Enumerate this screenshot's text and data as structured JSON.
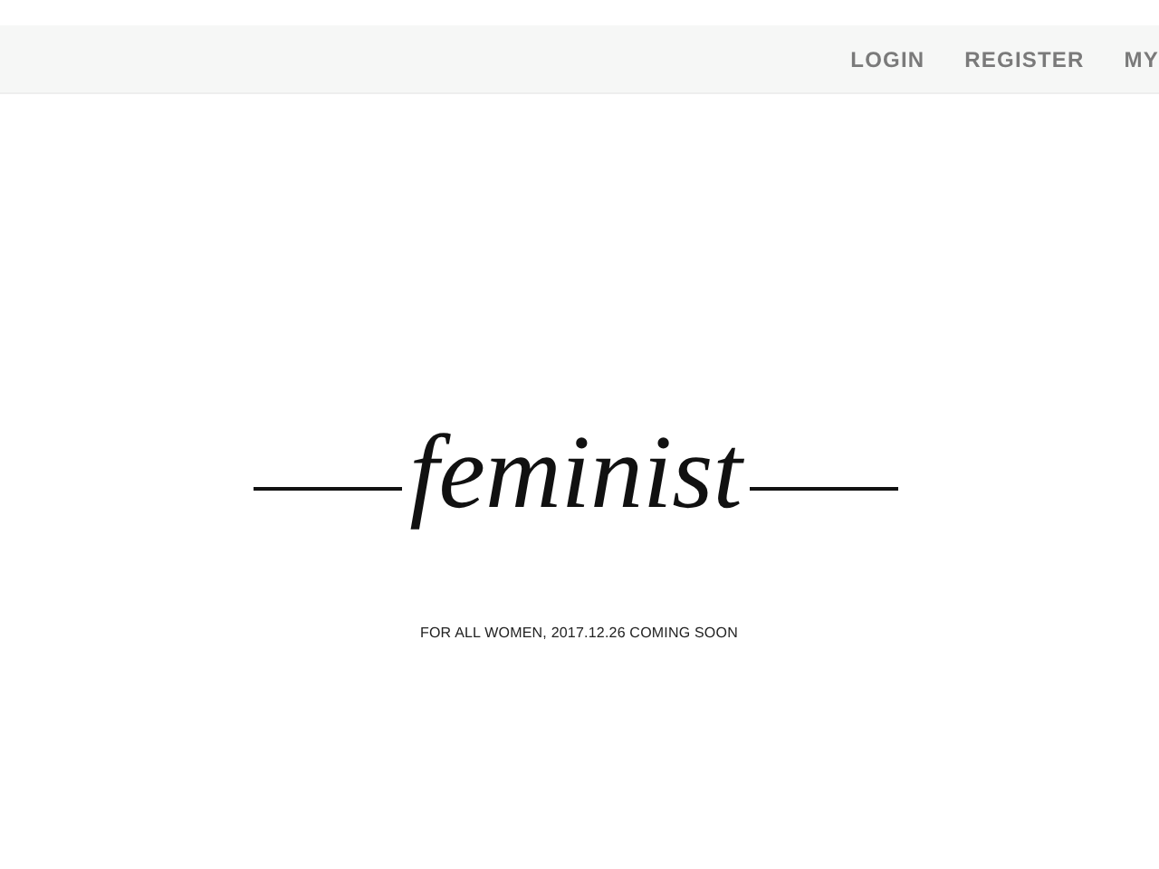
{
  "nav": [
    {
      "label": "LOGIN"
    },
    {
      "label": "REGISTER"
    },
    {
      "label": "MY"
    }
  ],
  "logo": {
    "text": "feminist"
  },
  "tagline": "FOR ALL WOMEN, 2017.12.26 COMING SOON"
}
